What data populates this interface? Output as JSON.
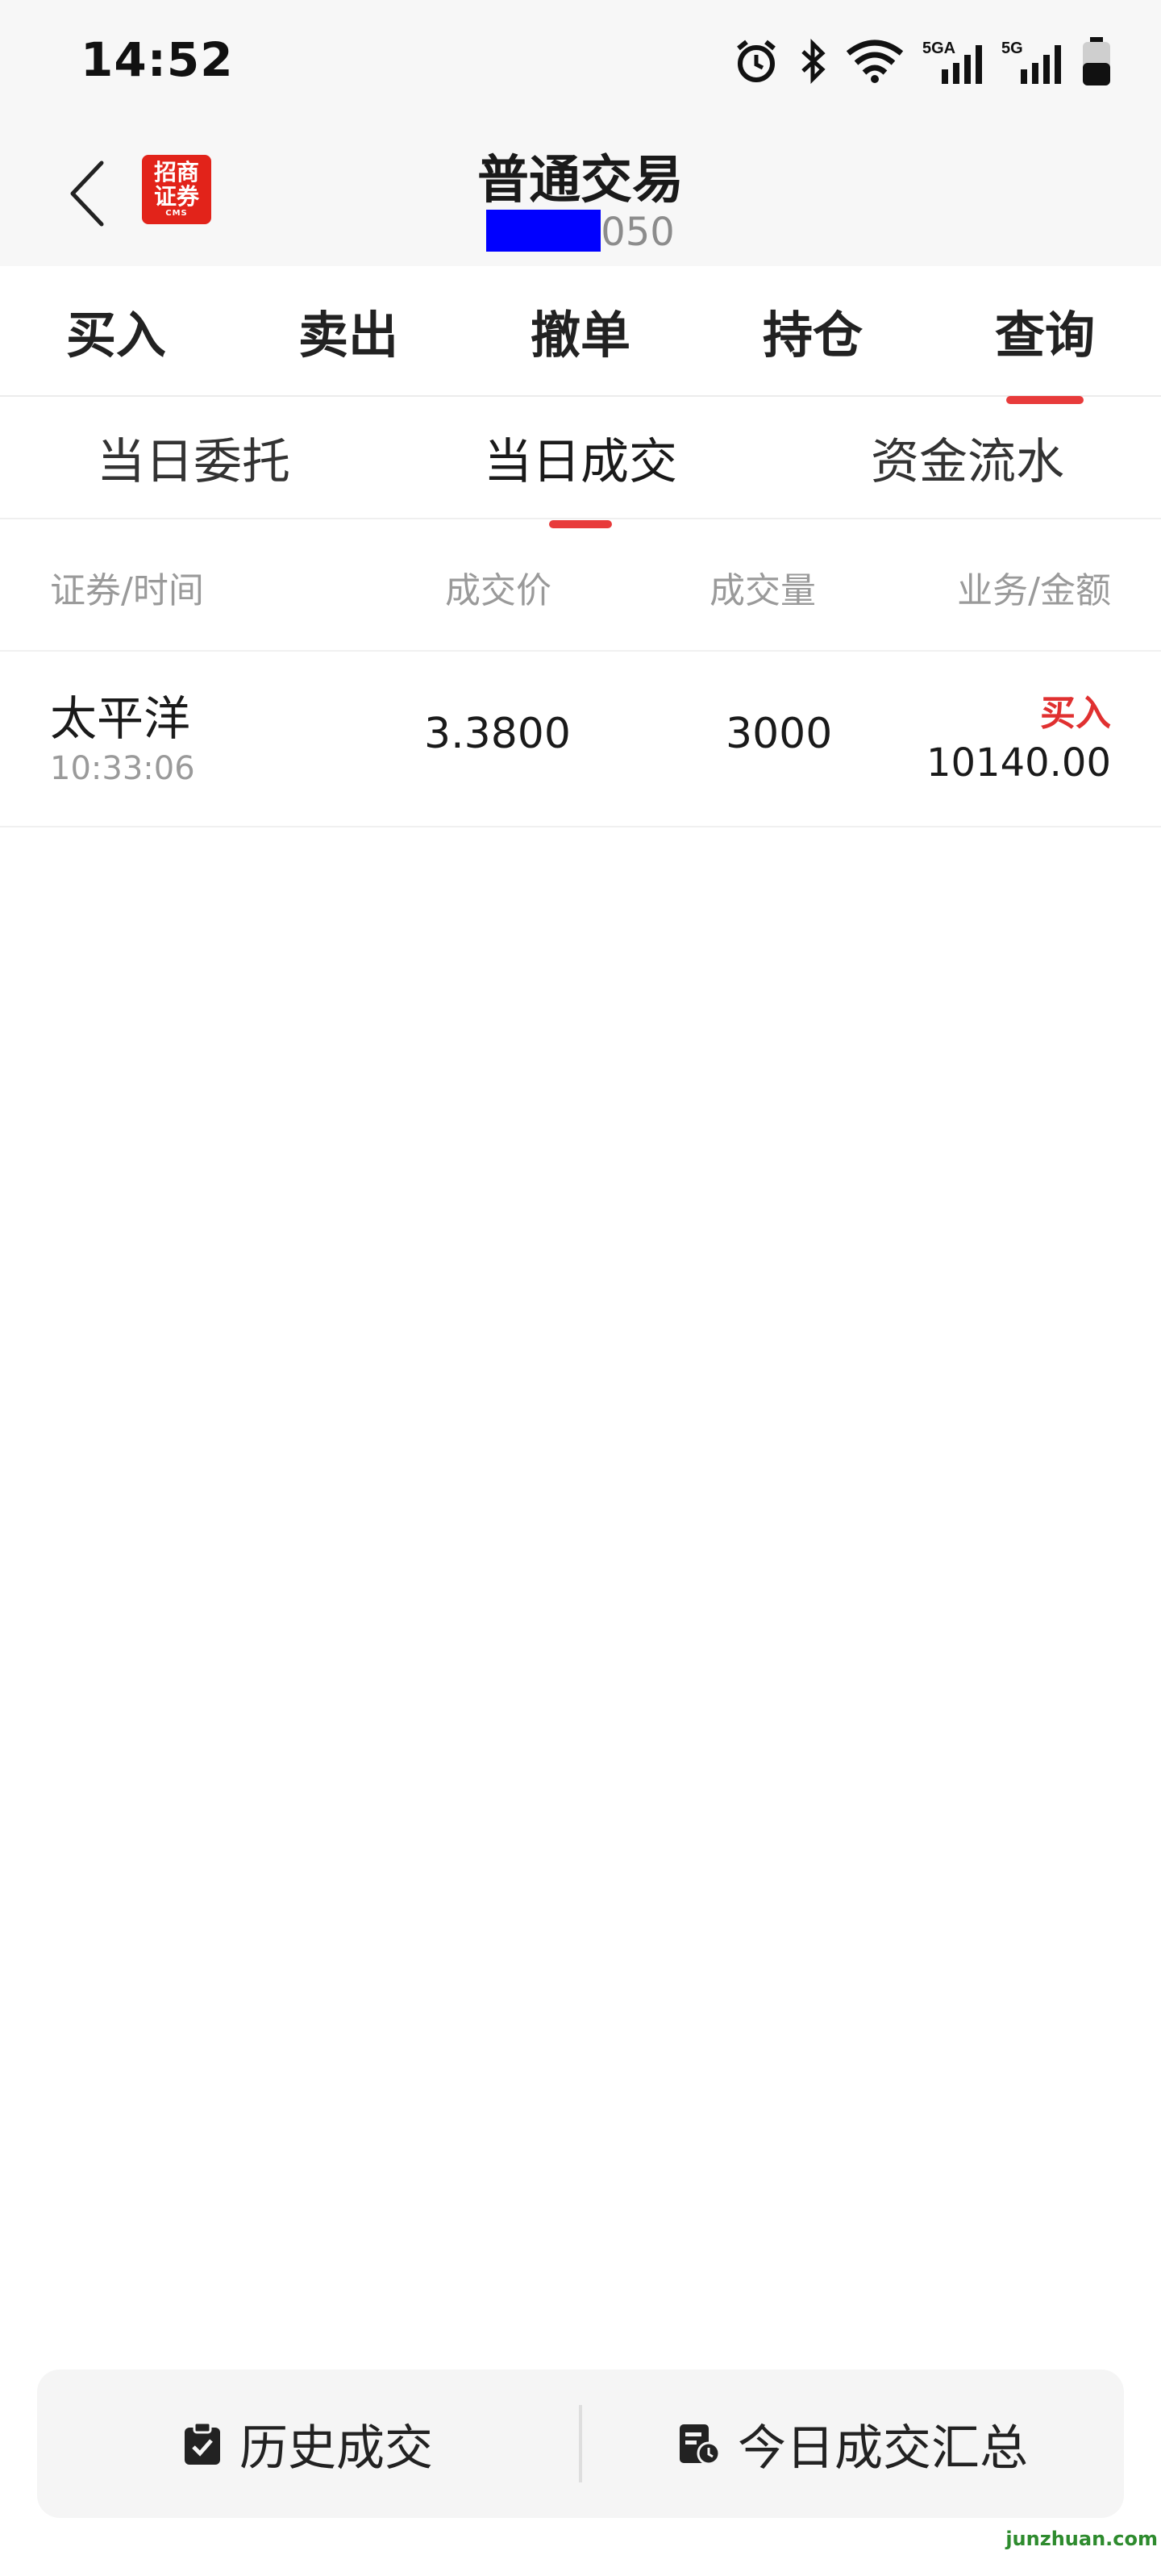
{
  "status_bar": {
    "time": "14:52",
    "icons": [
      "alarm-icon",
      "bluetooth-icon",
      "wifi-icon",
      "signal-5ga-icon",
      "signal-5g-icon",
      "battery-icon"
    ],
    "signal1_label": "5GA",
    "signal2_label": "5G"
  },
  "header": {
    "title": "普通交易",
    "account_suffix": "050",
    "logo_text": "招商证券",
    "logo_sub": "CMS"
  },
  "main_tabs": [
    {
      "label": "买入"
    },
    {
      "label": "卖出"
    },
    {
      "label": "撤单"
    },
    {
      "label": "持仓"
    },
    {
      "label": "查询",
      "active": true
    }
  ],
  "sub_tabs": [
    {
      "label": "当日委托"
    },
    {
      "label": "当日成交",
      "active": true
    },
    {
      "label": "资金流水"
    }
  ],
  "table": {
    "headers": [
      "证券/时间",
      "成交价",
      "成交量",
      "业务/金额"
    ],
    "rows": [
      {
        "name": "太平洋",
        "time": "10:33:06",
        "price": "3.3800",
        "quantity": "3000",
        "type": "买入",
        "amount": "10140.00"
      }
    ]
  },
  "bottom_bar": {
    "history_label": "历史成交",
    "summary_label": "今日成交汇总"
  },
  "watermark": "junzhuan.com",
  "colors": {
    "accent": "#e83b3b",
    "buy_text": "#e03030",
    "logo_bg": "#e2231a"
  }
}
